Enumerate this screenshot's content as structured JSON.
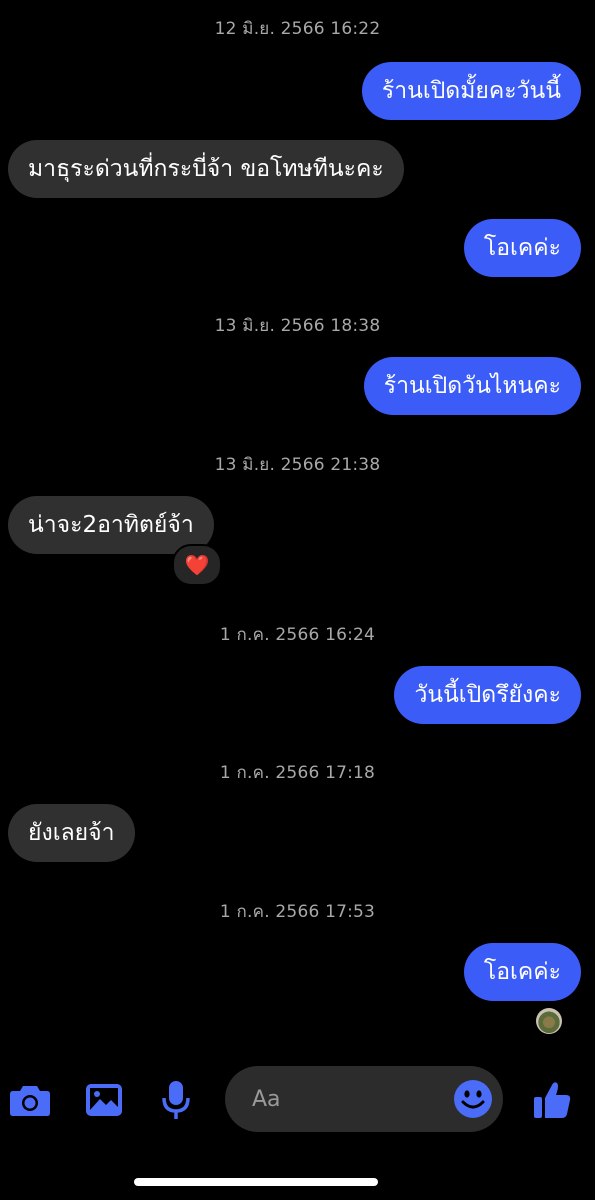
{
  "messages": [
    {
      "type": "timestamp",
      "text": "12 มิ.ย. 2566 16:22"
    },
    {
      "type": "out",
      "text": "ร้านเปิดมั้ยคะวันนี้"
    },
    {
      "type": "in",
      "text": "มาธุระด่วนที่กระบี่จ้า  ขอโทษทีนะคะ"
    },
    {
      "type": "out",
      "text": "โอเคค่ะ"
    },
    {
      "type": "timestamp",
      "text": "13 มิ.ย. 2566 18:38"
    },
    {
      "type": "out",
      "text": "ร้านเปิดวันไหนคะ"
    },
    {
      "type": "timestamp",
      "text": "13 มิ.ย. 2566 21:38"
    },
    {
      "type": "in",
      "text": "น่าจะ2อาทิตย์จ้า",
      "reaction": "❤️"
    },
    {
      "type": "timestamp",
      "text": "1 ก.ค. 2566 16:24"
    },
    {
      "type": "out",
      "text": "วันนี้เปิดรึยังคะ"
    },
    {
      "type": "timestamp",
      "text": "1 ก.ค. 2566 17:18"
    },
    {
      "type": "in",
      "text": "ยังเลยจ้า"
    },
    {
      "type": "timestamp",
      "text": "1 ก.ค. 2566 17:53"
    },
    {
      "type": "out",
      "text": "โอเคค่ะ"
    }
  ],
  "composer": {
    "placeholder": "Aa",
    "icons": [
      "camera-icon",
      "image-icon",
      "microphone-icon",
      "emoji-icon",
      "like-icon"
    ]
  },
  "colors": {
    "background": "#000000",
    "outgoing_bubble": "#3b5cf6",
    "incoming_bubble": "#303030",
    "timestamp": "#a8a8a8",
    "accent": "#4a6cf7"
  }
}
